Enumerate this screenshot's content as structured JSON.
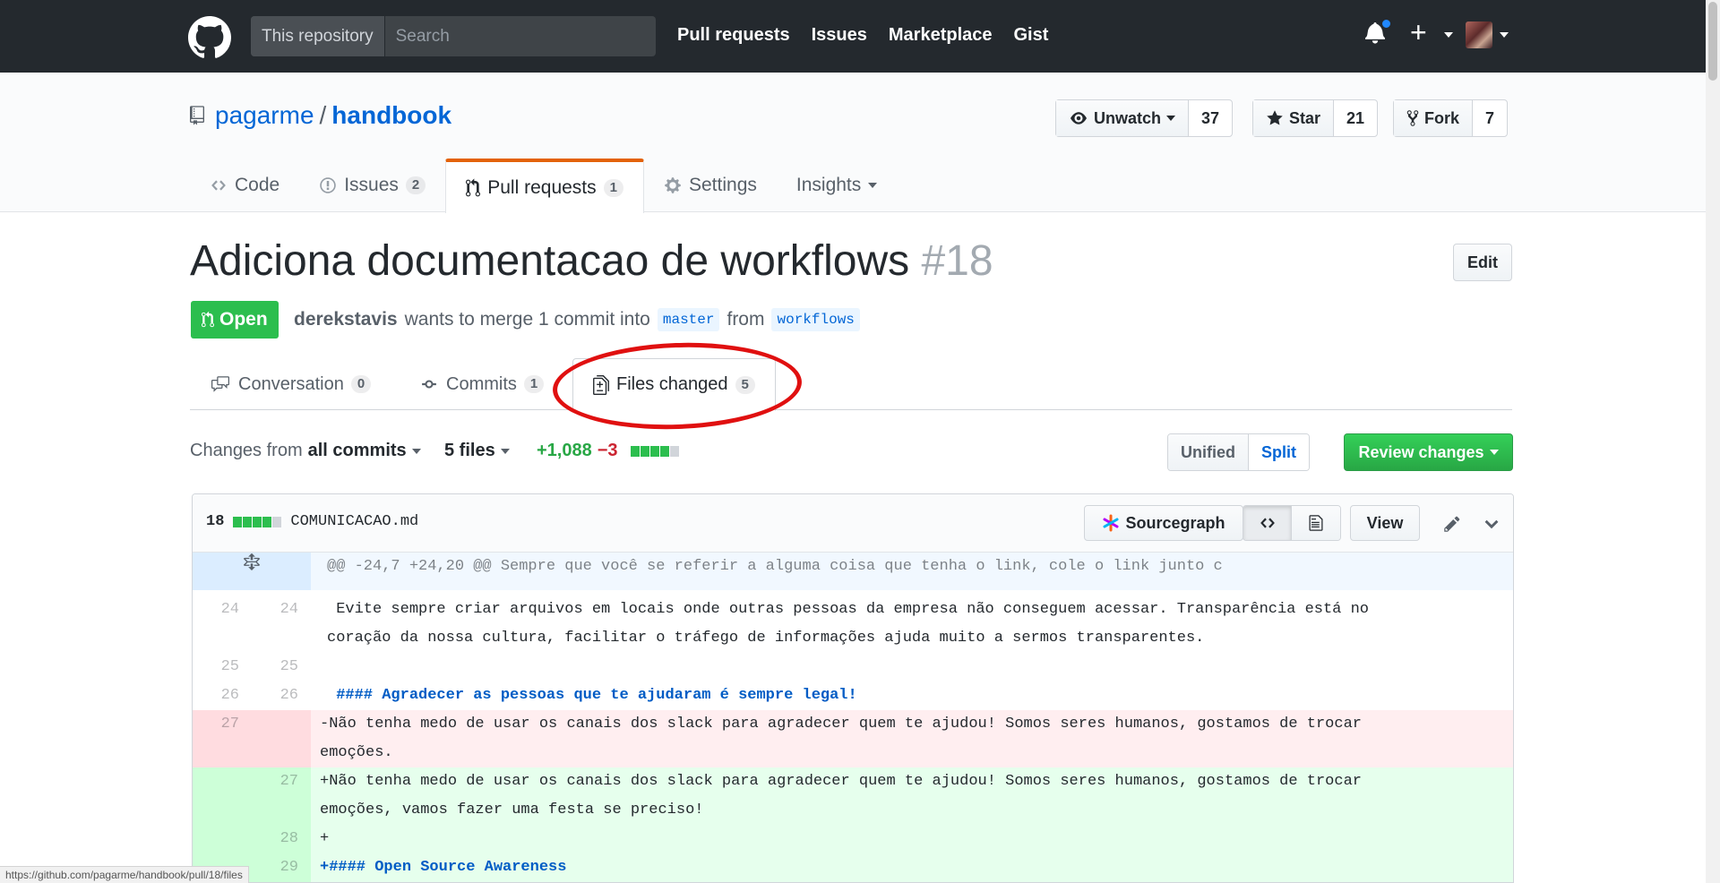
{
  "header": {
    "search_scope": "This repository",
    "search_placeholder": "Search",
    "nav": [
      "Pull requests",
      "Issues",
      "Marketplace",
      "Gist"
    ]
  },
  "repo": {
    "owner": "pagarme",
    "separator": "/",
    "name": "handbook",
    "unwatch_label": "Unwatch",
    "watch_count": "37",
    "star_label": "Star",
    "star_count": "21",
    "fork_label": "Fork",
    "fork_count": "7",
    "tabs": [
      {
        "label": "Code",
        "icon": "code-icon",
        "counter": ""
      },
      {
        "label": "Issues",
        "icon": "issue-icon",
        "counter": "2"
      },
      {
        "label": "Pull requests",
        "icon": "git-pull-request-icon",
        "counter": "1"
      },
      {
        "label": "Settings",
        "icon": "gear-icon",
        "counter": ""
      },
      {
        "label": "Insights",
        "icon": "",
        "counter": ""
      }
    ]
  },
  "pr": {
    "title": "Adiciona documentacao de workflows",
    "number": "#18",
    "edit_label": "Edit",
    "state": "Open",
    "author": "derekstavis",
    "merge_text": "wants to merge 1 commit into",
    "base_branch": "master",
    "from_text": "from",
    "head_branch": "workflows",
    "tabs": [
      {
        "label": "Conversation",
        "counter": "0"
      },
      {
        "label": "Commits",
        "counter": "1"
      },
      {
        "label": "Files changed",
        "counter": "5"
      }
    ]
  },
  "toolbar": {
    "changes_from": "Changes from",
    "all_commits": "all commits",
    "files": "5 files",
    "additions": "+1,088",
    "deletions": "−3",
    "unified": "Unified",
    "split": "Split",
    "review_changes": "Review changes"
  },
  "file": {
    "changes": "18",
    "name": "COMUNICACAO.md",
    "sourcegraph": "Sourcegraph",
    "view": "View",
    "hunk": "@@ -24,7 +24,20 @@ Sempre que você se referir a alguma coisa que tenha o link, cole o link junto c",
    "lines": [
      {
        "type": "ctx",
        "old": "24",
        "new": "24",
        "text": " Evite sempre criar arquivos em locais onde outras pessoas da empresa não conseguem acessar. Transparência está no coração da nossa cultura, facilitar o tráfego de informações ajuda muito a sermos transparentes."
      },
      {
        "type": "ctx",
        "old": "25",
        "new": "25",
        "text": " "
      },
      {
        "type": "ctx",
        "old": "26",
        "new": "26",
        "text": " #### Agradecer as pessoas que te ajudaram é sempre legal!"
      },
      {
        "type": "del",
        "old": "27",
        "new": "",
        "text": "-Não tenha medo de usar os canais dos slack para agradecer quem te ajudou! Somos seres humanos, gostamos de trocar emoções."
      },
      {
        "type": "add",
        "old": "",
        "new": "27",
        "text": "+Não tenha medo de usar os canais dos slack para agradecer quem te ajudou! Somos seres humanos, gostamos de trocar emoções, vamos fazer uma festa se preciso!"
      },
      {
        "type": "add",
        "old": "",
        "new": "28",
        "text": "+"
      },
      {
        "type": "add",
        "old": "",
        "new": "29",
        "text": "+#### Open Source Awareness"
      }
    ]
  },
  "statusbar": "https://github.com/pagarme/handbook/pull/18/files",
  "colors": {
    "accent": "#e36209",
    "open": "#2cbe4e",
    "link": "#0366d6",
    "annotation": "#e01010"
  }
}
